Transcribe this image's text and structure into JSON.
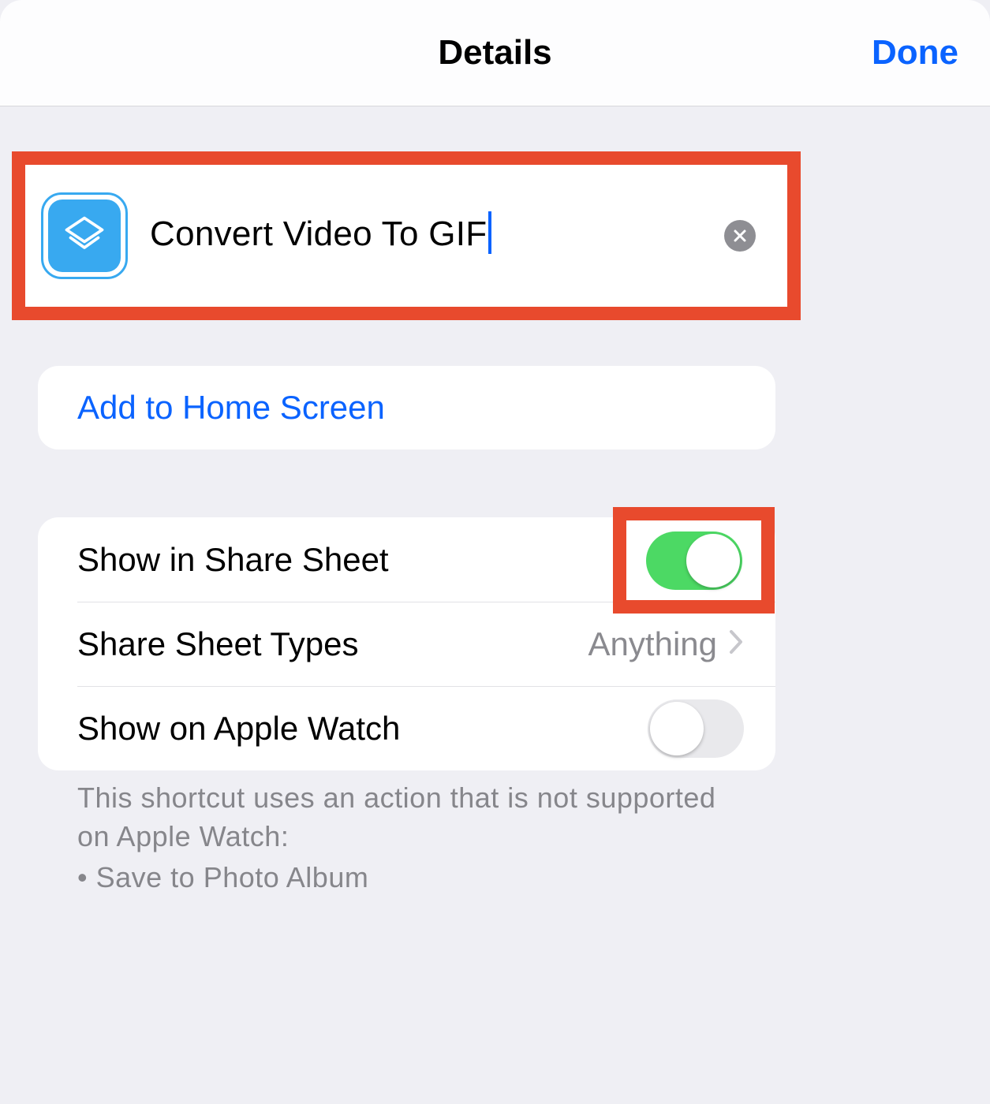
{
  "header": {
    "title": "Details",
    "done": "Done"
  },
  "shortcut": {
    "name": "Convert Video To GIF",
    "icon": "shortcuts-layers-icon"
  },
  "actions": {
    "add_to_home_screen": "Add to Home Screen"
  },
  "settings": {
    "share_sheet": {
      "label": "Show in Share Sheet",
      "on": true
    },
    "share_sheet_types": {
      "label": "Share Sheet Types",
      "value": "Anything"
    },
    "apple_watch": {
      "label": "Show on Apple Watch",
      "on": false
    }
  },
  "footer": {
    "line1": "This shortcut uses an action that is not supported on Apple Watch:",
    "line2": "• Save to Photo Album"
  },
  "colors": {
    "accent": "#0a63ff",
    "highlight": "#e84a2d",
    "toggle_on": "#4cd964",
    "icon_bg": "#38a9f0"
  }
}
